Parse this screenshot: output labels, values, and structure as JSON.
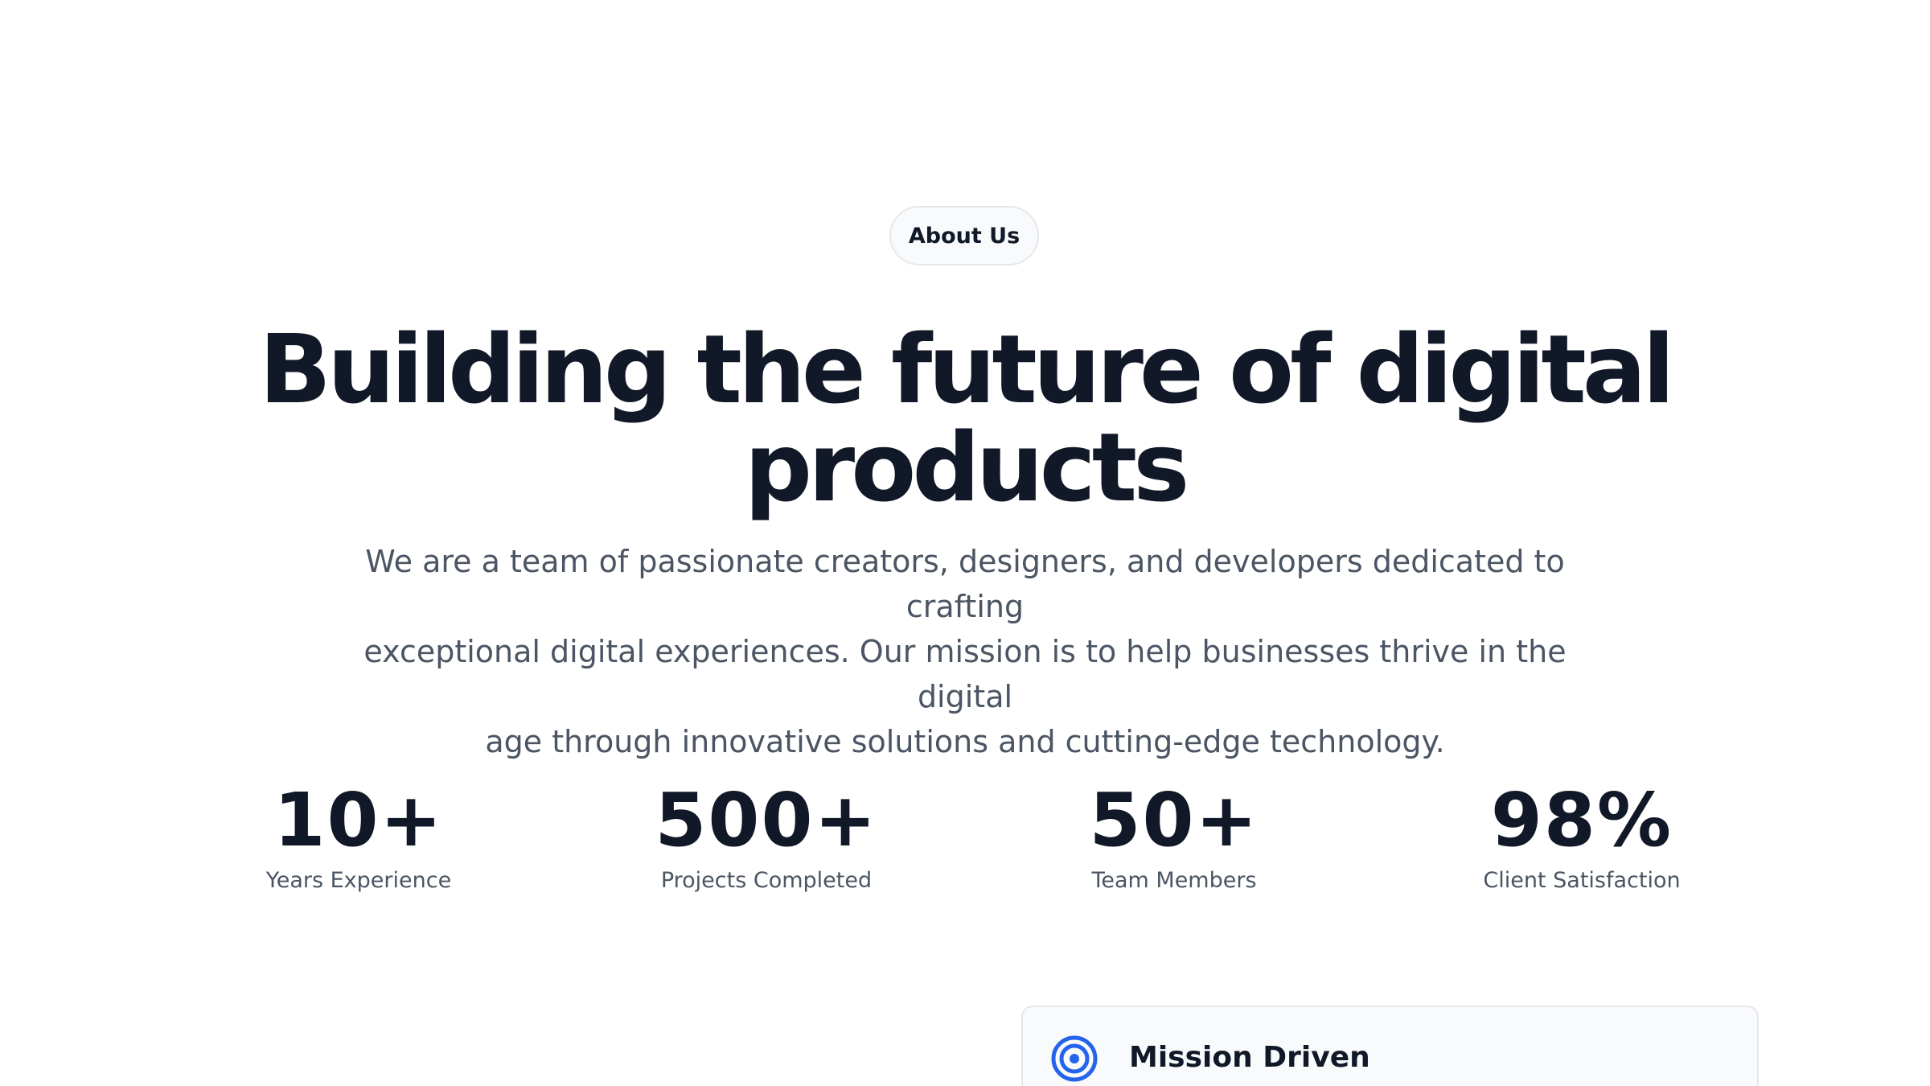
{
  "badge": {
    "label": "About Us"
  },
  "hero": {
    "headline_line1": "Building the future of digital",
    "headline_line2": "products",
    "description_line1": "We are a team of passionate creators, designers, and developers dedicated to crafting",
    "description_line2": "exceptional digital experiences. Our mission is to help businesses thrive in the digital",
    "description_line3": "age through innovative solutions and cutting-edge technology."
  },
  "stats": [
    {
      "value": "10+",
      "label": "Years Experience"
    },
    {
      "value": "500+",
      "label": "Projects Completed"
    },
    {
      "value": "50+",
      "label": "Team Members"
    },
    {
      "value": "98%",
      "label": "Client Satisfaction"
    }
  ],
  "feature": {
    "title": "Mission Driven",
    "icon": "target-icon",
    "accent": "#2563eb"
  }
}
